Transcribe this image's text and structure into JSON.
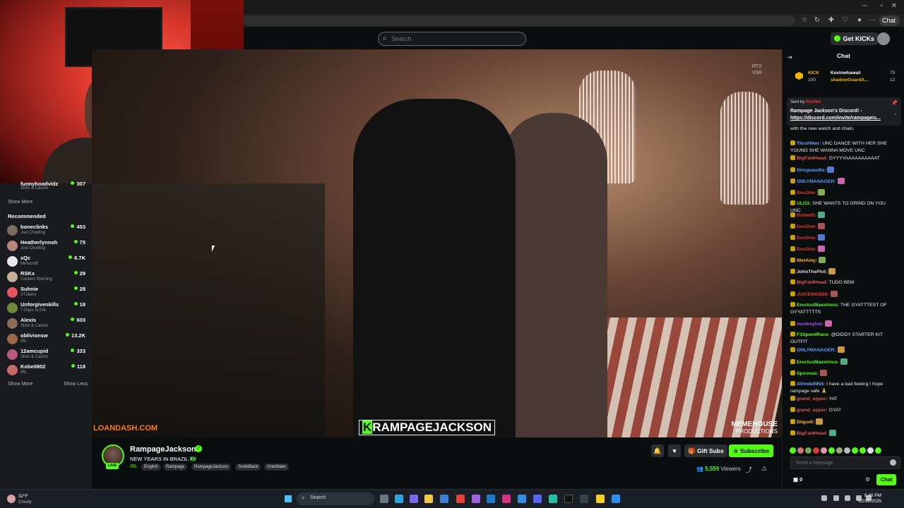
{
  "browser": {
    "chat_pill": "Chat"
  },
  "kick_nav": {
    "search_placeholder": "Search",
    "get_kicks": "Get KICKs"
  },
  "sidebar": {
    "top_partial": {
      "name": "funnyhoodvidz",
      "category": "Slots & Casino",
      "viewers": "307"
    },
    "show_more_1": "Show More",
    "recommended_title": "Recommended",
    "items": [
      {
        "name": "boneclinks",
        "category": "Just Chatting",
        "viewers": "453",
        "color": "#7c6b5f"
      },
      {
        "name": "Heatherlynnoh",
        "category": "Just Chatting",
        "viewers": "75",
        "color": "#b7867a"
      },
      {
        "name": "xQc",
        "category": "Minecraft",
        "viewers": "6.7K",
        "color": "#e7e7e7"
      },
      {
        "name": "RSKx",
        "category": "Content Warning",
        "viewers": "29",
        "color": "#c7b09a"
      },
      {
        "name": "Suhnie",
        "category": "VTubers",
        "viewers": "28",
        "color": "#e85562"
      },
      {
        "name": "Unforgivenkills",
        "category": "7 Days to Die",
        "viewers": "18",
        "color": "#6a8a3a"
      },
      {
        "name": "Alexis",
        "category": "Slots & Casino",
        "viewers": "603",
        "color": "#8c6a5a"
      },
      {
        "name": "oblivionsw",
        "category": "IRL",
        "viewers": "13.2K",
        "color": "#9a6a4a"
      },
      {
        "name": "12amcupid",
        "category": "Slots & Casino",
        "viewers": "333",
        "color": "#b95a7a"
      },
      {
        "name": "Kobe0802",
        "category": "IRL",
        "viewers": "118",
        "color": "#c76a6a"
      }
    ],
    "show_more_2": "Show More",
    "show_less": "Show Less"
  },
  "video": {
    "rtx_line1": "RTX",
    "rtx_line2": "VSR",
    "sponsor": "LOANDASH.COM",
    "overlay_k": "K",
    "overlay_rest": "RAMPAGEJACKSON",
    "memehouse_line1": "MEMEHOUSE",
    "memehouse_line2": "PRODUCTIONS"
  },
  "stream": {
    "live": "LIVE",
    "channel": "RampageJackson",
    "title": "NEW YEARS IN BRAZIL 🇧🇷",
    "category": "IRL",
    "tags": [
      "English",
      "Rampage",
      "RampageJackson",
      "SmileBack",
      "OneWater"
    ],
    "gift_subs": "Gift Subs",
    "subscribe": "Subscribe",
    "viewer_count": "5,559",
    "viewers_label": "Viewers"
  },
  "chat": {
    "title": "Chat",
    "leaderboard": {
      "label": "KICK",
      "label_value": "100",
      "first_name": "Kevinwhawaii",
      "first_value": "75",
      "second_name": "shadowGuardA...",
      "second_value": "12"
    },
    "pinned": {
      "sent_by": "Sent by",
      "sender": "RnbNet",
      "line1": "Rampage Jackson's Discord! -",
      "line2": "https://discord.com/invite/rampageis..."
    },
    "messages": [
      {
        "user": "",
        "color": "#ccc",
        "text": "with the new watch and chain."
      },
      {
        "user": "ThruHiker:",
        "color": "#7aa2ff",
        "text": "UNC DANCE WITH HER SHE YOUNG SHE WANNA MOVE UNC"
      },
      {
        "user": "BigFat4Head:",
        "color": "#e05a5a",
        "text": "GYYYYAAAAAAAAAAT"
      },
      {
        "user": "Sringsaudts:",
        "color": "#53a6ff",
        "text": ""
      },
      {
        "user": "ONLYMANAGER:",
        "color": "#5b9bff",
        "text": ""
      },
      {
        "user": "DosOne:",
        "color": "#e0382f",
        "text": ""
      },
      {
        "user": "ULI11:",
        "color": "#53fc18",
        "text": "SHE WANTS TO GRIND ON YOU UNC"
      },
      {
        "user": "Rollie95:",
        "color": "#e0382f",
        "text": ""
      },
      {
        "user": "DosOne:",
        "color": "#e0382f",
        "text": ""
      },
      {
        "user": "DosOne:",
        "color": "#e0382f",
        "text": ""
      },
      {
        "user": "DosOne:",
        "color": "#e0382f",
        "text": ""
      },
      {
        "user": "WetAmy:",
        "color": "#ffb13b",
        "text": ""
      },
      {
        "user": "JohnThePlot:",
        "color": "#ddd",
        "text": ""
      },
      {
        "user": "BigFat4Head:",
        "color": "#e05a5a",
        "text": "TUDO BEM"
      },
      {
        "user": "JUICEMOB88:",
        "color": "#e0382f",
        "text": ""
      },
      {
        "user": "ErectusMaeximus:",
        "color": "#53fc18",
        "text": "THE GYATTTEST OF GYYATTTTTS"
      },
      {
        "user": "monkeyloo:",
        "color": "#b14aff",
        "text": ""
      },
      {
        "user": "F3SpeedRace:",
        "color": "#53fc18",
        "text": "@DIDDY STARTER KIT OUTFIT"
      },
      {
        "user": "ONLYMANAGER:",
        "color": "#5b9bff",
        "text": ""
      },
      {
        "user": "ErectusMaeximus:",
        "color": "#53fc18",
        "text": ""
      },
      {
        "user": "Spoonas:",
        "color": "#53fc18",
        "text": ""
      },
      {
        "user": "AVindell954:",
        "color": "#7aa2ff",
        "text": "I have a bad feeling I hope rampage safe 🙏"
      },
      {
        "user": "grand_upper:",
        "color": "#e05a5a",
        "text": "YAT"
      },
      {
        "user": "grand_upper:",
        "color": "#e05a5a",
        "text": "GYAT"
      },
      {
        "user": "Diigodi:",
        "color": "#ffb13b",
        "text": ""
      },
      {
        "user": "BigFat4Head:",
        "color": "#e05a5a",
        "text": ""
      }
    ],
    "input_placeholder": "Send a message",
    "kick_count": "0",
    "send": "Chat"
  },
  "taskbar": {
    "temperature": "32°F",
    "condition": "Cloudy",
    "search": "Search",
    "time": "8:46 PM",
    "date": "12/31/2025"
  }
}
